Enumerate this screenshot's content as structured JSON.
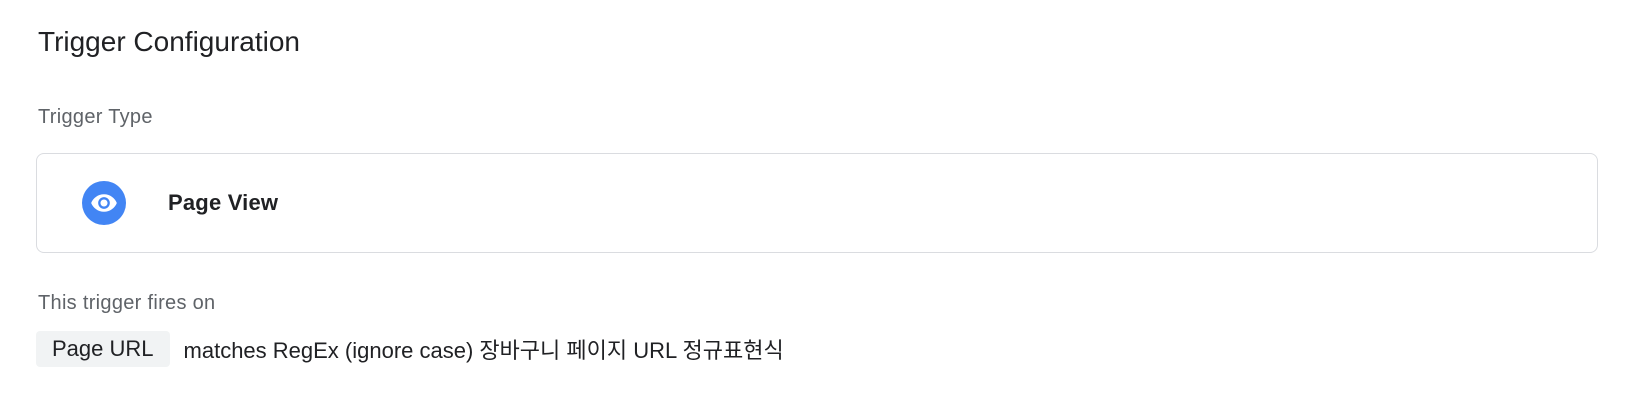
{
  "header": {
    "title": "Trigger Configuration"
  },
  "trigger_type": {
    "label": "Trigger Type",
    "card": {
      "icon": "eye-icon",
      "icon_color": "#4285f4",
      "name": "Page View"
    }
  },
  "fires_on": {
    "label": "This trigger fires on",
    "condition": {
      "variable": "Page URL",
      "operator": "matches RegEx (ignore case)",
      "value": "장바구니 페이지 URL 정규표현식"
    }
  }
}
